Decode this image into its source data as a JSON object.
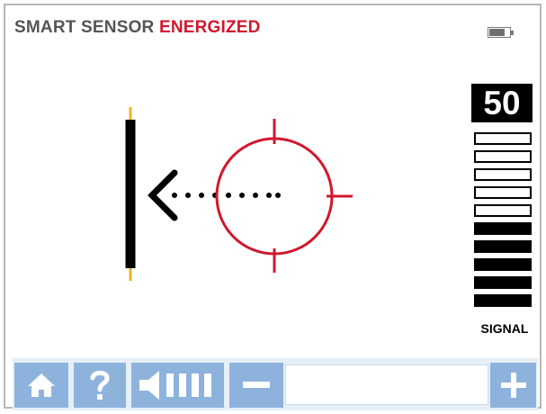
{
  "header": {
    "title_prefix": "SMART SENSOR",
    "title_status": "ENERGIZED"
  },
  "colors": {
    "status_red": "#d1172d",
    "button_blue": "#8db3dc",
    "toolbar_bg": "#e6eff7",
    "cable_tick": "#f0b323"
  },
  "battery": {
    "icon": "battery-icon",
    "level": 0.7
  },
  "signal": {
    "value": "50",
    "label": "SIGNAL",
    "bars_total": 10,
    "bars_filled": 5
  },
  "locator": {
    "cable_icon": "cable-line-icon",
    "arrow_icon": "chevron-left-arrow-icon",
    "target_icon": "crosshair-target-icon",
    "direction": "left"
  },
  "toolbar": {
    "home_icon": "home-icon",
    "help_icon": "question-mark-icon",
    "volume_icon": "speaker-volume-icon",
    "volume_level": 4,
    "volume_max": 4,
    "decrease_icon": "minus-icon",
    "increase_icon": "plus-icon"
  }
}
